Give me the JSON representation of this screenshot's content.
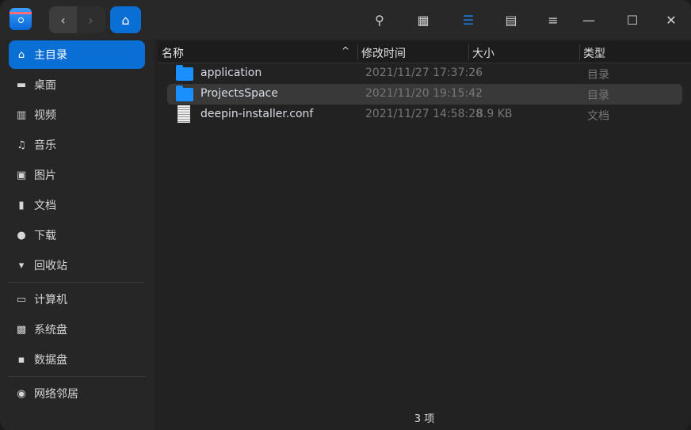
{
  "toolbar": {
    "back": "‹",
    "forward": "›"
  },
  "sidebar": {
    "items": [
      {
        "label": "主目录",
        "icon": "home-icon"
      },
      {
        "label": "桌面",
        "icon": "desktop-icon"
      },
      {
        "label": "视频",
        "icon": "video-icon"
      },
      {
        "label": "音乐",
        "icon": "music-icon"
      },
      {
        "label": "图片",
        "icon": "picture-icon"
      },
      {
        "label": "文档",
        "icon": "document-icon"
      },
      {
        "label": "下载",
        "icon": "download-icon"
      },
      {
        "label": "回收站",
        "icon": "trash-icon"
      },
      {
        "label": "计算机",
        "icon": "computer-icon"
      },
      {
        "label": "系统盘",
        "icon": "disk-icon"
      },
      {
        "label": "数据盘",
        "icon": "disk-icon"
      },
      {
        "label": "网络邻居",
        "icon": "network-icon"
      }
    ]
  },
  "columns": {
    "name": "名称",
    "time": "修改时间",
    "size": "大小",
    "type": "类型"
  },
  "files": [
    {
      "name": "application",
      "time": "2021/11/27 17:37:26",
      "size": "-",
      "type": "目录"
    },
    {
      "name": "ProjectsSpace",
      "time": "2021/11/20 19:15:42",
      "size": "-",
      "type": "目录"
    },
    {
      "name": "deepin-installer.conf",
      "time": "2021/11/27 14:58:28",
      "size": "8.9 KB",
      "type": "文档"
    }
  ],
  "status": "3 项",
  "colors": {
    "accent": "#0a6fd5"
  }
}
